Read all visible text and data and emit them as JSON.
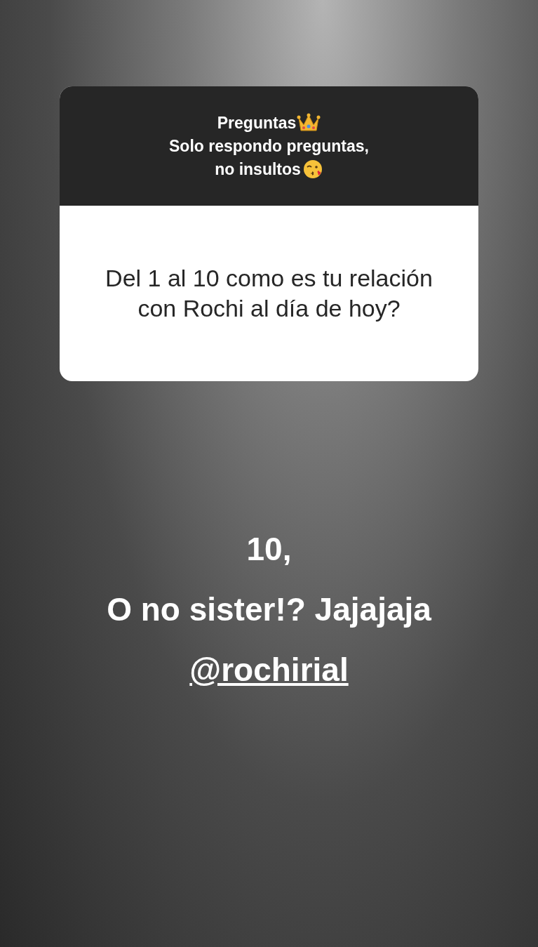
{
  "question_box": {
    "title": "Preguntas",
    "subtitle_lines": [
      "Solo respondo preguntas,",
      "no insultos"
    ],
    "question": "Del 1 al 10 como es tu relación con Rochi al día de hoy?"
  },
  "answer": {
    "lines": [
      "10,",
      "O no sister!? Jajajaja"
    ],
    "mention": "@rochirial"
  }
}
